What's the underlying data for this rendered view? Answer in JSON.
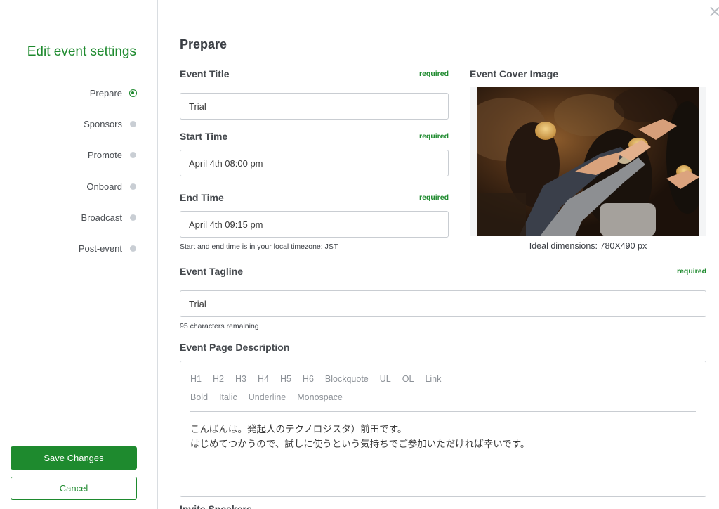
{
  "sidebar": {
    "title": "Edit event settings",
    "steps": [
      {
        "label": "Prepare",
        "state": "active"
      },
      {
        "label": "Sponsors",
        "state": "inactive"
      },
      {
        "label": "Promote",
        "state": "inactive"
      },
      {
        "label": "Onboard",
        "state": "inactive"
      },
      {
        "label": "Broadcast",
        "state": "inactive"
      },
      {
        "label": "Post-event",
        "state": "inactive"
      }
    ],
    "save_label": "Save Changes",
    "cancel_label": "Cancel"
  },
  "main": {
    "section_title": "Prepare",
    "required_text": "required",
    "event_title": {
      "label": "Event Title",
      "value": "Trial"
    },
    "start_time": {
      "label": "Start Time",
      "value": "April 4th 08:00 pm"
    },
    "end_time": {
      "label": "End Time",
      "value": "April 4th 09:15 pm"
    },
    "timezone_hint": "Start and end time is in your local timezone: JST",
    "cover": {
      "label": "Event Cover Image",
      "caption": "Ideal dimensions: 780X490 px"
    },
    "tagline": {
      "label": "Event Tagline",
      "value": "Trial",
      "remaining": "95 characters remaining"
    },
    "description": {
      "label": "Event Page Description",
      "toolbar_row1": [
        "H1",
        "H2",
        "H3",
        "H4",
        "H5",
        "H6",
        "Blockquote",
        "UL",
        "OL",
        "Link"
      ],
      "toolbar_row2": [
        "Bold",
        "Italic",
        "Underline",
        "Monospace"
      ],
      "line1": "こんばんは。発起人のテクノロジスタ）前田です。",
      "line2": "はじめてつかうので、試しに使うという気持ちでご参加いただければ幸いです。"
    },
    "next_label_partial": "Invite Speakers"
  },
  "colors": {
    "accent": "#1e8a2e",
    "border": "#c9cdd2",
    "inactive_dot": "#c9ced4"
  }
}
